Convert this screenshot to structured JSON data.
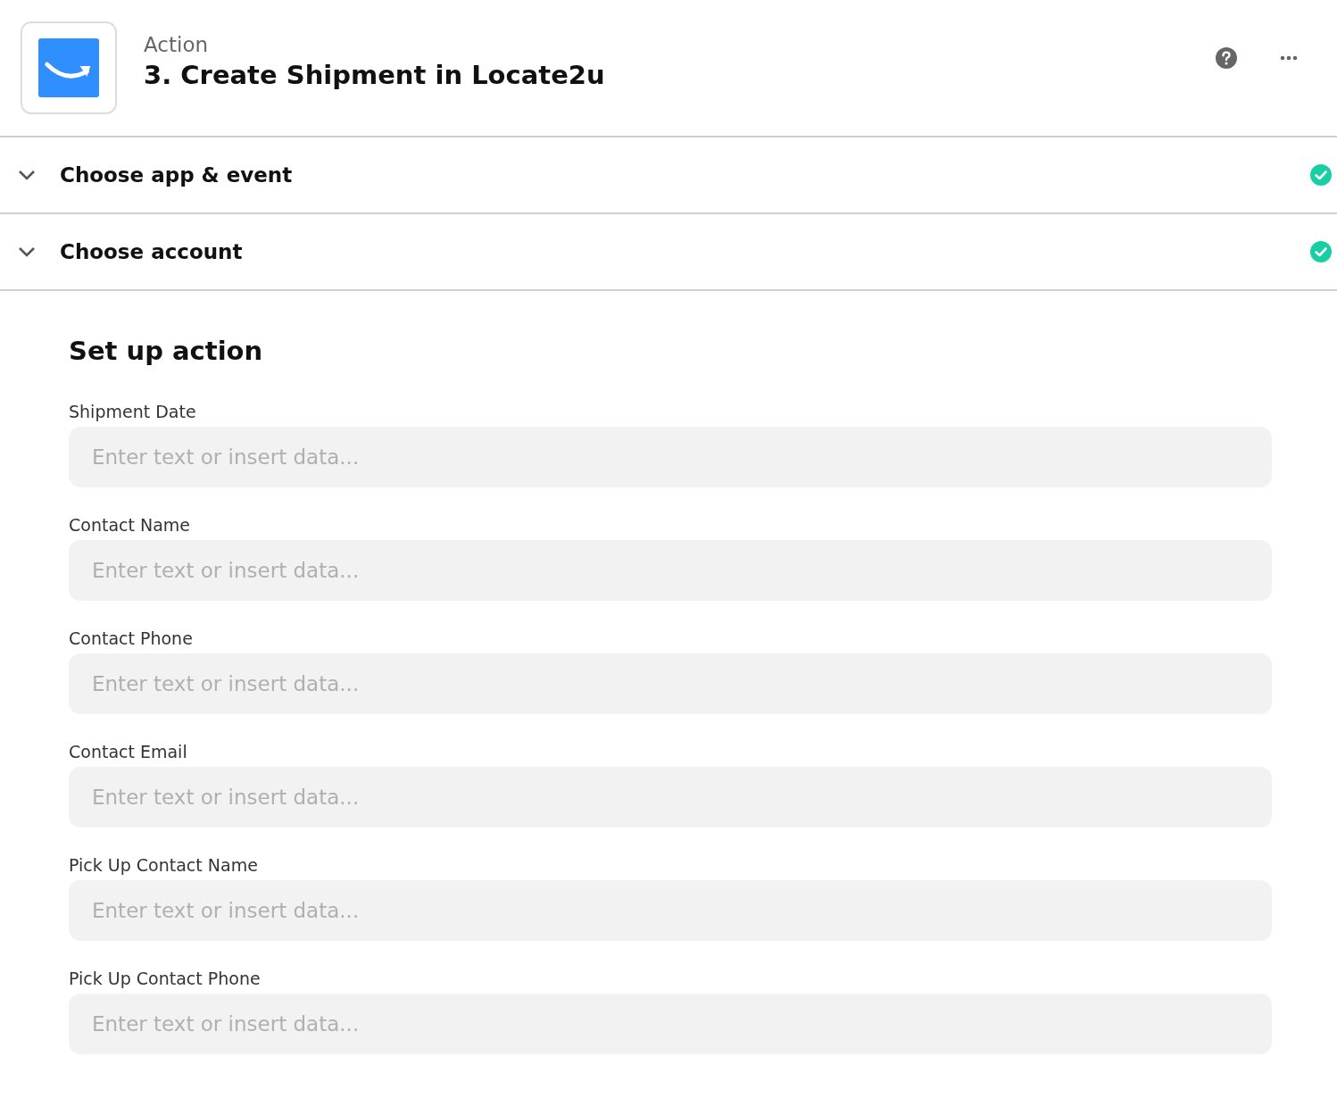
{
  "header": {
    "kind_label": "Action",
    "title": "3. Create Shipment in Locate2u"
  },
  "sections": [
    {
      "title": "Choose app & event",
      "expanded": false,
      "complete": true
    },
    {
      "title": "Choose account",
      "expanded": false,
      "complete": true
    }
  ],
  "setup": {
    "title": "Set up action",
    "fields": [
      {
        "label": "Shipment Date",
        "placeholder": "Enter text or insert data..."
      },
      {
        "label": "Contact Name",
        "placeholder": "Enter text or insert data..."
      },
      {
        "label": "Contact Phone",
        "placeholder": "Enter text or insert data..."
      },
      {
        "label": "Contact Email",
        "placeholder": "Enter text or insert data..."
      },
      {
        "label": "Pick Up Contact Name",
        "placeholder": "Enter text or insert data..."
      },
      {
        "label": "Pick Up Contact Phone",
        "placeholder": "Enter text or insert data..."
      }
    ]
  }
}
